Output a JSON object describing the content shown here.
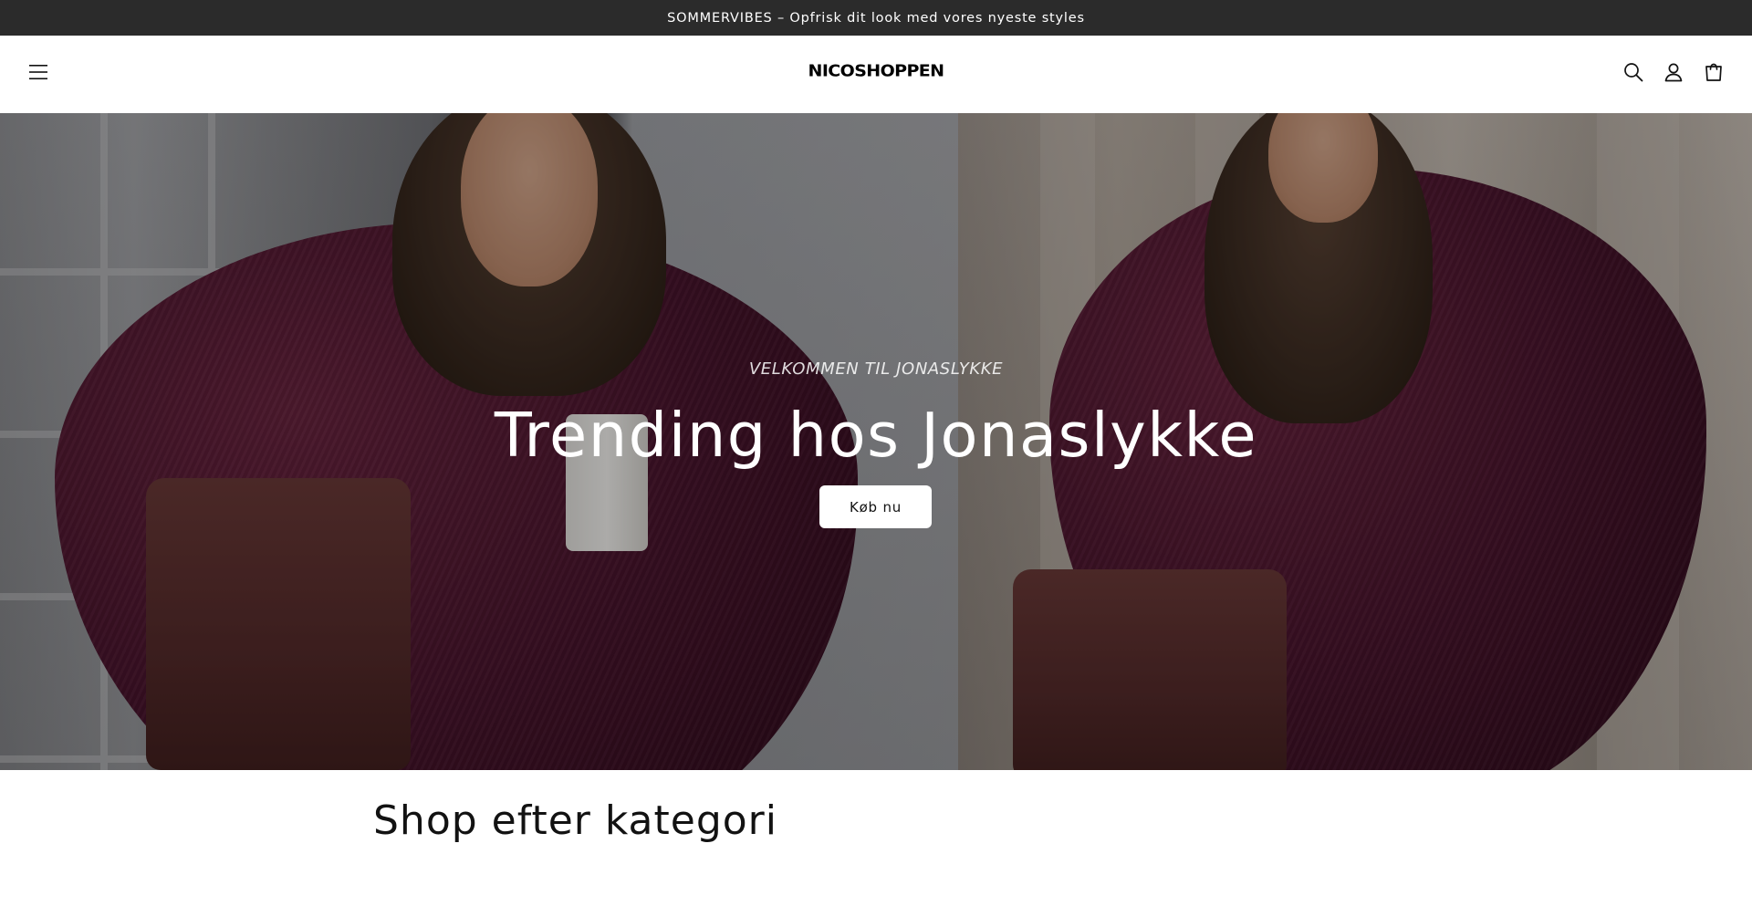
{
  "announcement": {
    "text": "SOMMERVIBES – Opfrisk dit look med vores nyeste styles"
  },
  "header": {
    "logo": "NICOSHOPPEN",
    "icons": [
      "menu-icon",
      "search-icon",
      "account-icon",
      "cart-icon"
    ]
  },
  "hero": {
    "kicker": "VELKOMMEN TIL JONASLYKKE",
    "title": "Trending hos Jonaslykke",
    "button_label": "Køb nu"
  },
  "category": {
    "title": "Shop efter kategori"
  },
  "colors": {
    "announcement_bg": "#2b2b2b",
    "text": "#121212",
    "button_bg": "#ffffff",
    "coat": "#4e1630"
  }
}
